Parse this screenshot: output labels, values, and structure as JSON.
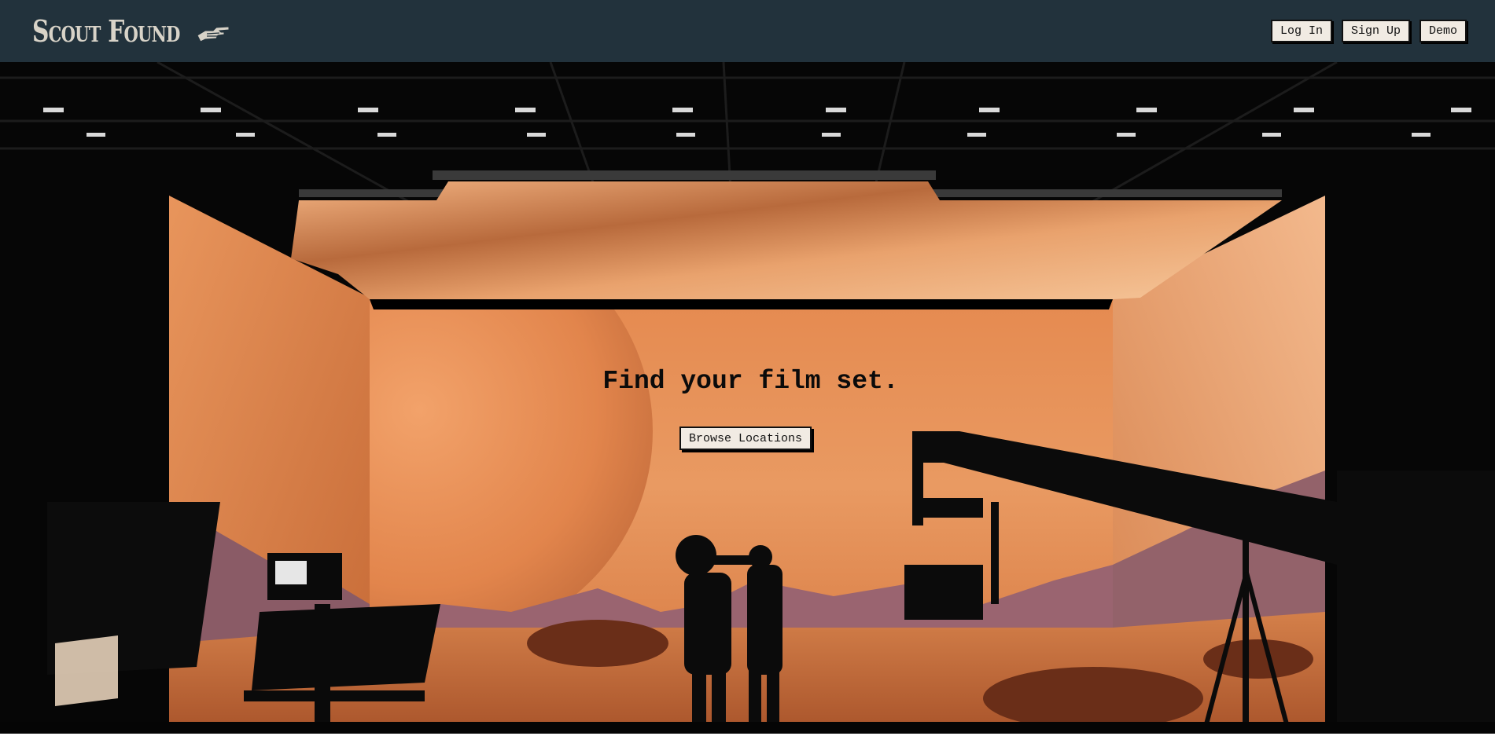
{
  "header": {
    "logo_text": "Scout Found",
    "logo_icon": "pointing-hand-icon",
    "nav": {
      "login_label": "Log In",
      "signup_label": "Sign Up",
      "demo_label": "Demo"
    }
  },
  "hero": {
    "headline": "Find your film set.",
    "cta_label": "Browse Locations",
    "background": "film-studio-mars-set-image"
  },
  "colors": {
    "header_bg": "#22323c",
    "button_bg": "#f1ebe3",
    "accent_orange": "#d9783b"
  }
}
